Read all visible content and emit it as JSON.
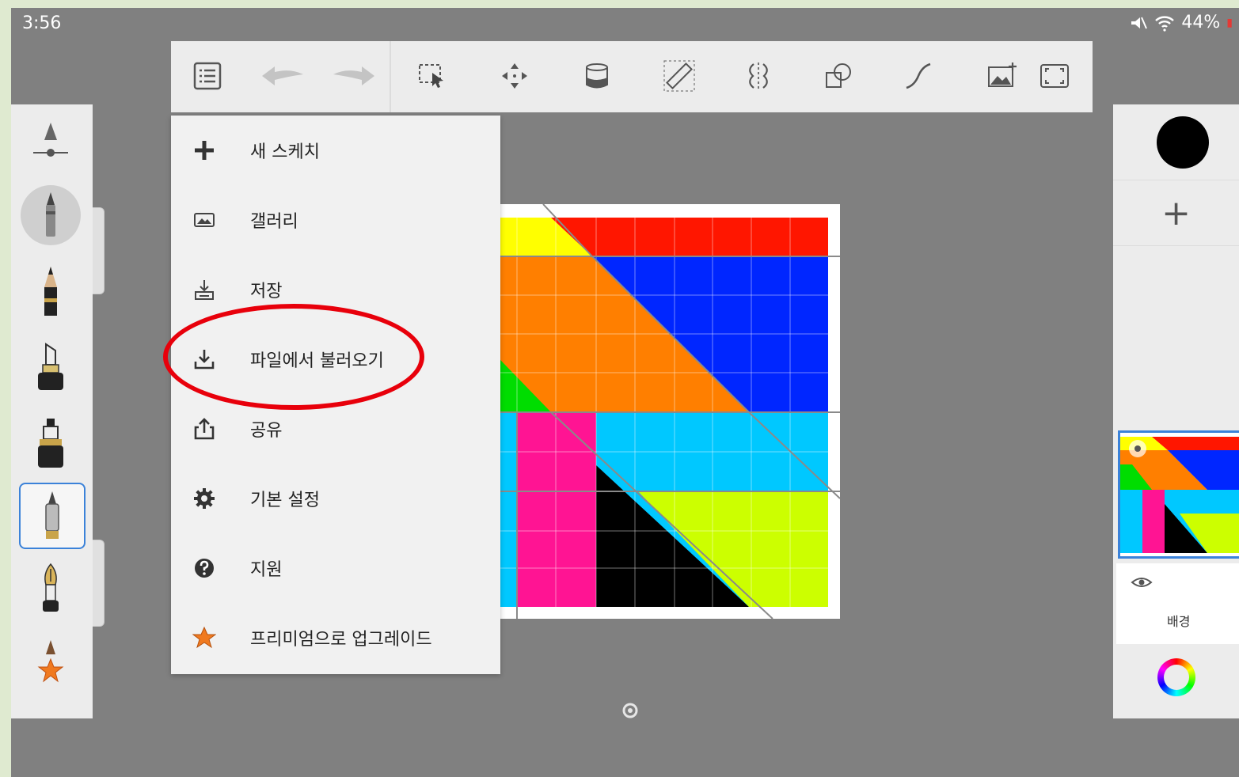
{
  "status_bar": {
    "time": "3:56",
    "battery": "44%"
  },
  "menu": {
    "items": [
      {
        "label": "새 스케치",
        "icon": "plus-icon"
      },
      {
        "label": "갤러리",
        "icon": "gallery-icon"
      },
      {
        "label": "저장",
        "icon": "save-icon"
      },
      {
        "label": "파일에서 불러오기",
        "icon": "import-icon"
      },
      {
        "label": "공유",
        "icon": "share-icon"
      },
      {
        "label": "기본 설정",
        "icon": "gear-icon"
      },
      {
        "label": "지원",
        "icon": "help-icon"
      },
      {
        "label": "프리미엄으로 업그레이드",
        "icon": "star-icon"
      }
    ]
  },
  "layers": {
    "background_label": "배경"
  },
  "colors": {
    "accent": "#3b82d9",
    "highlight": "#e8000b",
    "current_color": "#000000"
  }
}
